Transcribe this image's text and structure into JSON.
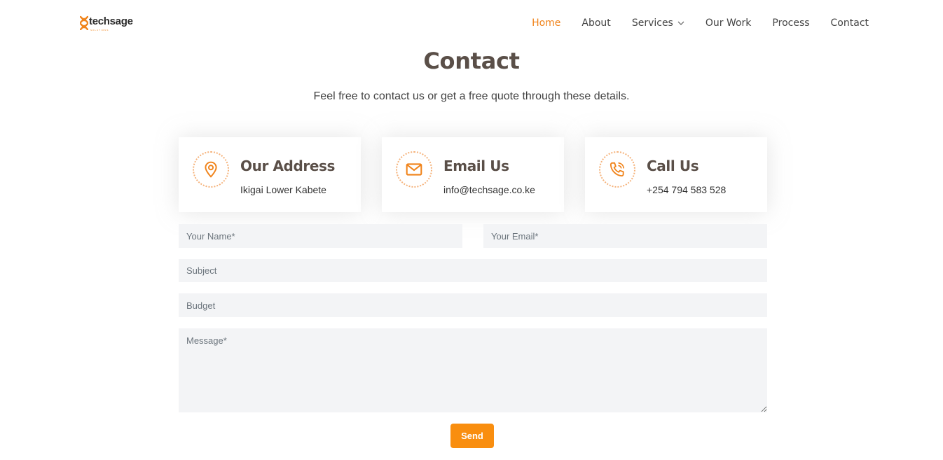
{
  "brand": {
    "name": "techsage",
    "tagline": "SOLUTIONS",
    "accent_color": "#f0831a"
  },
  "nav": {
    "items": [
      {
        "label": "Home",
        "active": true
      },
      {
        "label": "About"
      },
      {
        "label": "Services",
        "has_dropdown": true
      },
      {
        "label": "Our Work"
      },
      {
        "label": "Process"
      },
      {
        "label": "Contact"
      }
    ]
  },
  "section": {
    "title": "Contact",
    "subtitle": "Feel free to contact us or get a free quote through these details."
  },
  "cards": [
    {
      "icon": "map-pin-icon",
      "title": "Our Address",
      "text": "Ikigai Lower Kabete"
    },
    {
      "icon": "envelope-icon",
      "title": "Email Us",
      "text": "info@techsage.co.ke"
    },
    {
      "icon": "phone-icon",
      "title": "Call Us",
      "text": "+254 794 583 528"
    }
  ],
  "form": {
    "name_placeholder": "Your Name*",
    "email_placeholder": "Your Email*",
    "subject_placeholder": "Subject",
    "budget_placeholder": "Budget",
    "message_placeholder": "Message*",
    "send_label": "Send",
    "button_color": "#f98e0f"
  }
}
